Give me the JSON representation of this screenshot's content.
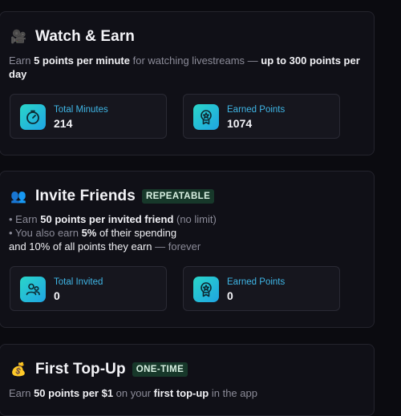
{
  "watch": {
    "emoji": "🎥",
    "title": "Watch & Earn",
    "desc": {
      "p1": "Earn ",
      "b1": "5 points per minute",
      "p2": " for watching livestreams — ",
      "b2": "up to 300 points per day"
    },
    "stats": [
      {
        "label": "Total Minutes",
        "value": "214",
        "icon": "timer-icon"
      },
      {
        "label": "Earned Points",
        "value": "1074",
        "icon": "award-icon"
      }
    ]
  },
  "invite": {
    "emoji": "👥",
    "title": "Invite Friends",
    "badge": "REPEATABLE",
    "desc": {
      "l1a": "• Earn ",
      "l1b": "50 points per invited friend",
      "l1c": " (no limit)",
      "l2a": "• You also earn ",
      "l2b": "5%",
      "l2c": " of their spending",
      "l3a": "and 10% of all points they earn",
      "l3b": " — forever"
    },
    "stats": [
      {
        "label": "Total Invited",
        "value": "0",
        "icon": "users-icon"
      },
      {
        "label": "Earned Points",
        "value": "0",
        "icon": "award-icon"
      }
    ]
  },
  "topup": {
    "emoji": "💰",
    "title": "First Top-Up",
    "badge": "ONE-TIME",
    "desc": {
      "p1": "Earn ",
      "b1": "50 points per $1",
      "p2": " on your ",
      "b2": "first top-up",
      "p3": " in the app"
    }
  },
  "colors": {
    "background": "#0b0b10",
    "card": "#101017",
    "accent": "#3fb6e6",
    "badge": "#17382a"
  }
}
